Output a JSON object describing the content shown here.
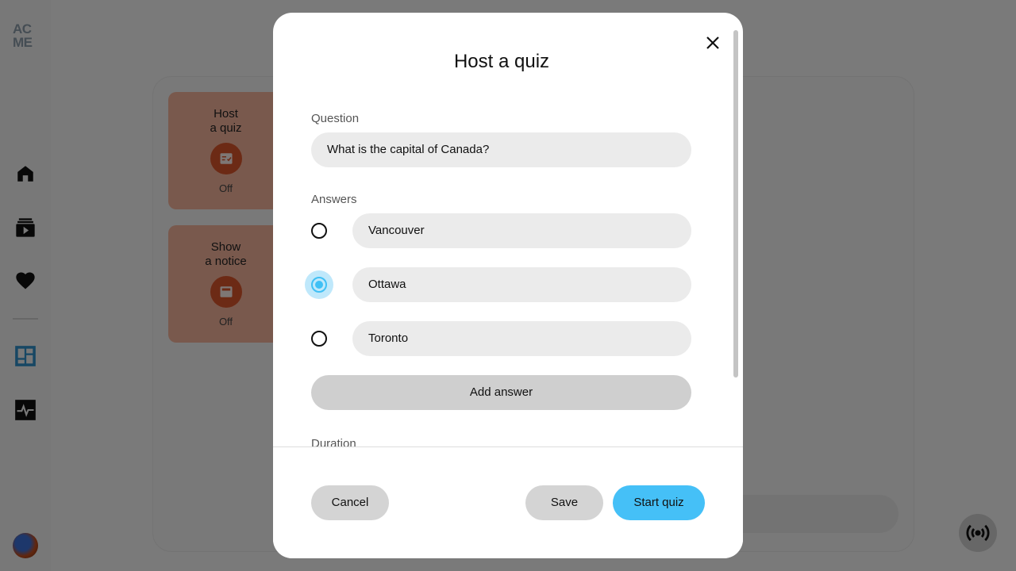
{
  "sidebar": {
    "logo_line1": "AC",
    "logo_line2": "ME",
    "items": [
      {
        "icon": "home-icon"
      },
      {
        "icon": "video-library-icon"
      },
      {
        "icon": "heart-icon"
      },
      {
        "icon": "dashboard-icon"
      },
      {
        "icon": "activity-icon"
      }
    ]
  },
  "cards": [
    {
      "title": "Host\na quiz",
      "icon": "quiz-icon",
      "status": "Off"
    },
    {
      "title": "Show\na notice",
      "icon": "notice-icon",
      "status": "Off"
    }
  ],
  "modal": {
    "title": "Host a quiz",
    "question_label": "Question",
    "question_value": "What is the capital of Canada?",
    "answers_label": "Answers",
    "answers": [
      {
        "text": "Vancouver",
        "selected": false
      },
      {
        "text": "Ottawa",
        "selected": true
      },
      {
        "text": "Toronto",
        "selected": false
      }
    ],
    "add_answer_label": "Add answer",
    "duration_label": "Duration",
    "cancel_label": "Cancel",
    "save_label": "Save",
    "start_label": "Start quiz"
  },
  "colors": {
    "accent": "#45c0f7",
    "card": "#f2b29a",
    "card_icon": "#d9542b"
  }
}
